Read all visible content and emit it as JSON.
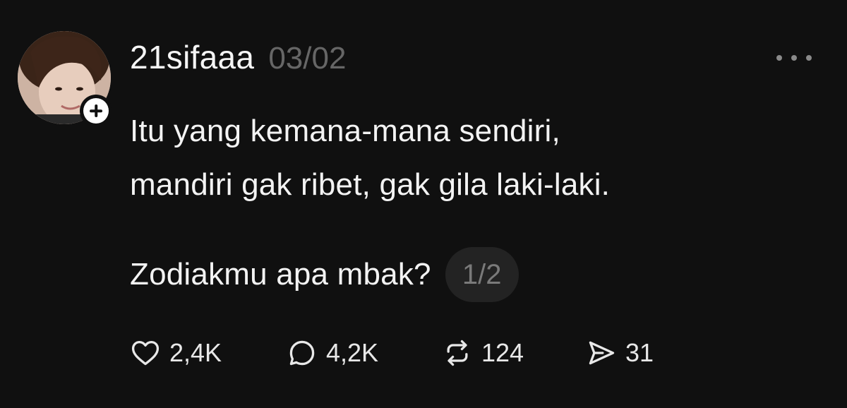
{
  "post": {
    "author": {
      "username": "21sifaaa",
      "avatar_icon": "profile-photo",
      "follow_icon": "plus-icon"
    },
    "timestamp": "03/02",
    "more_icon": "more-horizontal-icon",
    "text_lines": [
      "Itu yang kemana-mana sendiri,",
      "mandiri gak ribet, gak gila laki-laki."
    ],
    "last_line": "Zodiakmu apa mbak?",
    "page_indicator": "1/2",
    "actions": {
      "like": {
        "icon": "heart-icon",
        "count": "2,4K"
      },
      "reply": {
        "icon": "comment-icon",
        "count": "4,2K"
      },
      "repost": {
        "icon": "repost-icon",
        "count": "124"
      },
      "share": {
        "icon": "send-icon",
        "count": "31"
      }
    }
  },
  "colors": {
    "background": "#101010",
    "text": "#f3f3f3",
    "muted": "#666666",
    "pill_bg": "#232323"
  }
}
